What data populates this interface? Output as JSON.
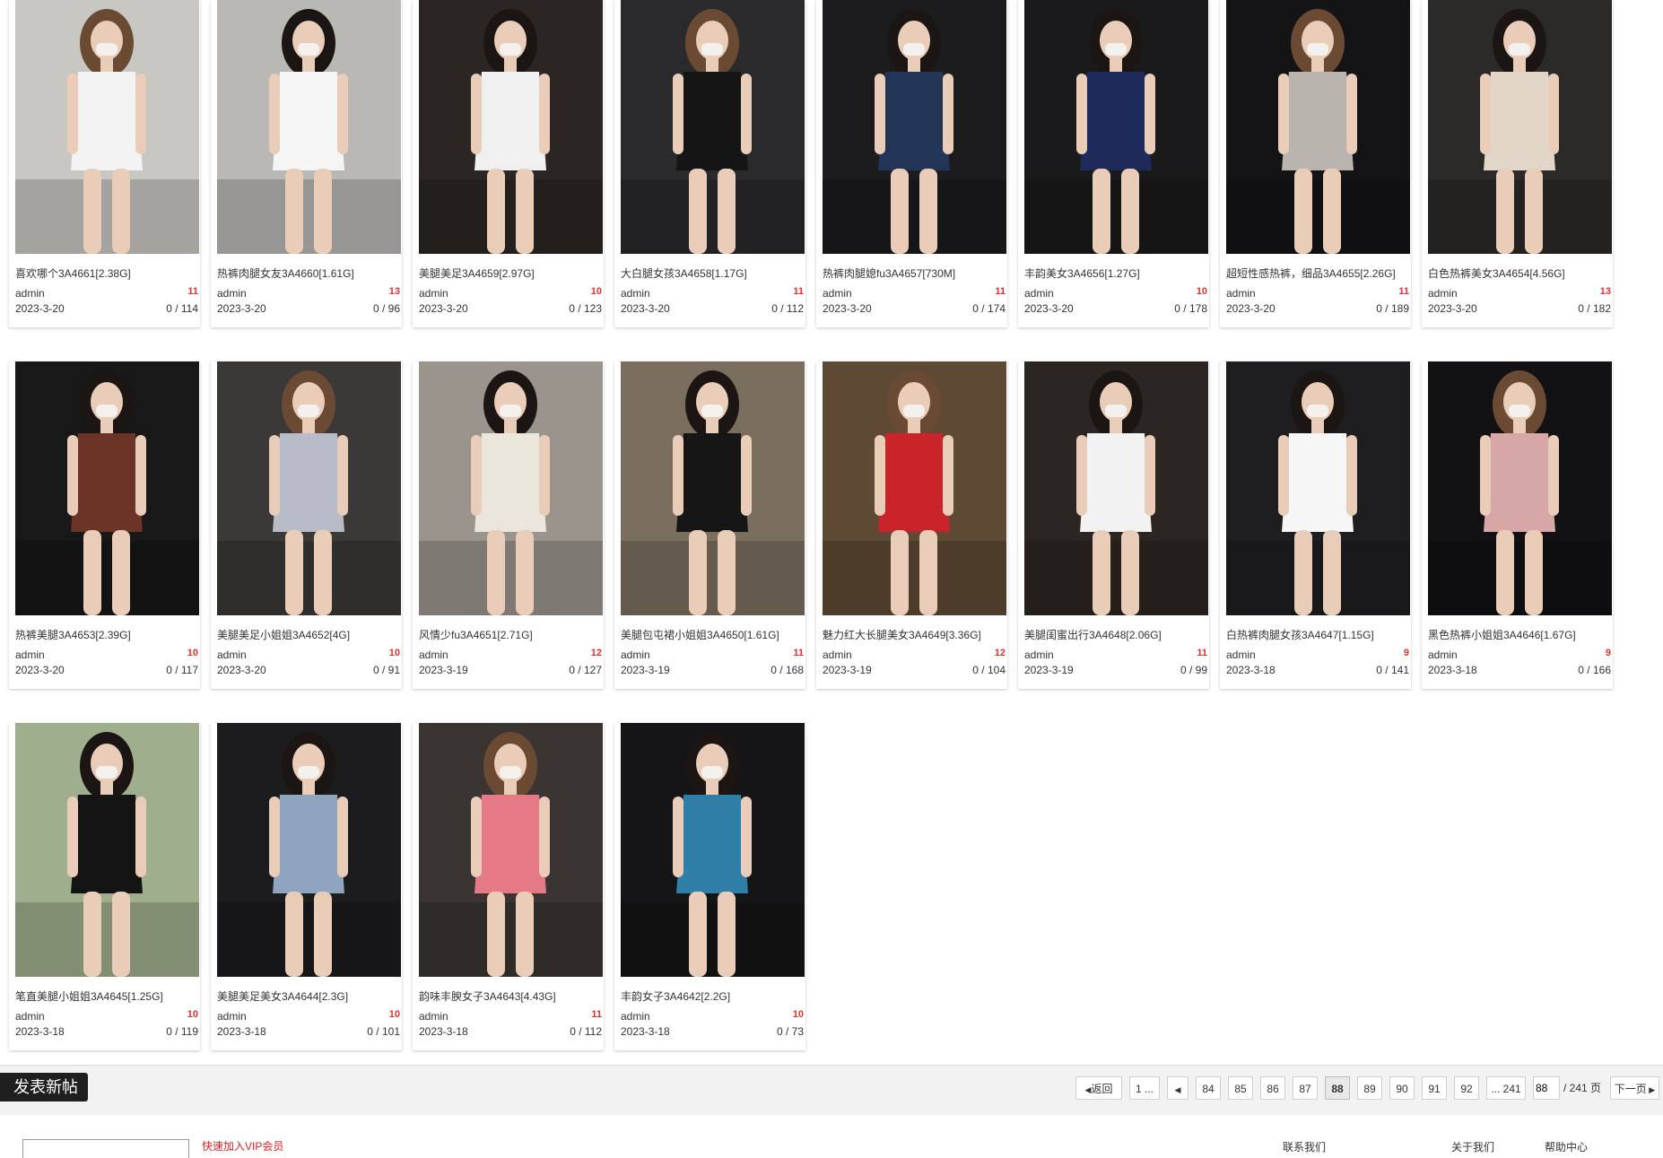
{
  "posts": [
    {
      "title": "喜欢哪个3A4661[2.38G]",
      "author": "admin",
      "images": "11",
      "date": "2023-3-20",
      "stats": "0 / 114",
      "bg": "#c9c7c2",
      "dress": "#f3f3f3"
    },
    {
      "title": "热裤肉腿女友3A4660[1.61G]",
      "author": "admin",
      "images": "13",
      "date": "2023-3-20",
      "stats": "0 / 96",
      "bg": "#b9b8b5",
      "dress": "#f5f5f5"
    },
    {
      "title": "美腿美足3A4659[2.97G]",
      "author": "admin",
      "images": "10",
      "date": "2023-3-20",
      "stats": "0 / 123",
      "bg": "#2b2623",
      "dress": "#f0f0f0"
    },
    {
      "title": "大白腿女孩3A4658[1.17G]",
      "author": "admin",
      "images": "11",
      "date": "2023-3-20",
      "stats": "0 / 112",
      "bg": "#2a2a2c",
      "dress": "#151515"
    },
    {
      "title": "热裤肉腿媳fu3A4657[730M]",
      "author": "admin",
      "images": "11",
      "date": "2023-3-20",
      "stats": "0 / 174",
      "bg": "#1c1c1e",
      "dress": "#223556"
    },
    {
      "title": "丰韵美女3A4656[1.27G]",
      "author": "admin",
      "images": "10",
      "date": "2023-3-20",
      "stats": "0 / 178",
      "bg": "#1a1a1c",
      "dress": "#1e2a5a"
    },
    {
      "title": "超短性感热裤，细品3A4655[2.26G]",
      "author": "admin",
      "images": "11",
      "date": "2023-3-20",
      "stats": "0 / 189",
      "bg": "#141416",
      "dress": "#b9b4ad"
    },
    {
      "title": "白色热裤美女3A4654[4.56G]",
      "author": "admin",
      "images": "13",
      "date": "2023-3-20",
      "stats": "0 / 182",
      "bg": "#2c2a28",
      "dress": "#e2d6c8"
    },
    {
      "title": "热裤美腿3A4653[2.39G]",
      "author": "admin",
      "images": "10",
      "date": "2023-3-20",
      "stats": "0 / 117",
      "bg": "#181818",
      "dress": "#6b3427"
    },
    {
      "title": "美腿美足小姐姐3A4652[4G]",
      "author": "admin",
      "images": "10",
      "date": "2023-3-20",
      "stats": "0 / 91",
      "bg": "#3a3937",
      "dress": "#b8bcc8"
    },
    {
      "title": "风情少fu3A4651[2.71G]",
      "author": "admin",
      "images": "12",
      "date": "2023-3-19",
      "stats": "0 / 127",
      "bg": "#9a948c",
      "dress": "#ebe6dc"
    },
    {
      "title": "美腿包屯裙小姐姐3A4650[1.61G]",
      "author": "admin",
      "images": "11",
      "date": "2023-3-19",
      "stats": "0 / 168",
      "bg": "#7a6e5e",
      "dress": "#161616"
    },
    {
      "title": "魅力红大长腿美女3A4649[3.36G]",
      "author": "admin",
      "images": "12",
      "date": "2023-3-19",
      "stats": "0 / 104",
      "bg": "#5e4a34",
      "dress": "#c8242a"
    },
    {
      "title": "美腿闺蜜出行3A4648[2.06G]",
      "author": "admin",
      "images": "11",
      "date": "2023-3-19",
      "stats": "0 / 99",
      "bg": "#2c2622",
      "dress": "#f2f2f2"
    },
    {
      "title": "白热裤肉腿女孩3A4647[1.15G]",
      "author": "admin",
      "images": "9",
      "date": "2023-3-18",
      "stats": "0 / 141",
      "bg": "#1e1e20",
      "dress": "#f6f6f6"
    },
    {
      "title": "黑色热裤小姐姐3A4646[1.67G]",
      "author": "admin",
      "images": "9",
      "date": "2023-3-18",
      "stats": "0 / 166",
      "bg": "#121214",
      "dress": "#d7a7a7"
    },
    {
      "title": "笔直美腿小姐姐3A4645[1.25G]",
      "author": "admin",
      "images": "10",
      "date": "2023-3-18",
      "stats": "0 / 119",
      "bg": "#9fae8c",
      "dress": "#141414"
    },
    {
      "title": "美腿美足美女3A4644[2.3G]",
      "author": "admin",
      "images": "10",
      "date": "2023-3-18",
      "stats": "0 / 101",
      "bg": "#1c1c1e",
      "dress": "#8ea4bf"
    },
    {
      "title": "韵味丰腴女子3A4643[4.43G]",
      "author": "admin",
      "images": "11",
      "date": "2023-3-18",
      "stats": "0 / 112",
      "bg": "#3a3532",
      "dress": "#e57a86"
    },
    {
      "title": "丰韵女子3A4642[2.2G]",
      "author": "admin",
      "images": "10",
      "date": "2023-3-18",
      "stats": "0 / 73",
      "bg": "#151517",
      "dress": "#2e7ea8"
    }
  ],
  "new_post_label": "发表新帖",
  "pagination": {
    "back": "返回",
    "first": "1 ...",
    "pages": [
      "84",
      "85",
      "86",
      "87",
      "88",
      "89",
      "90",
      "91",
      "92"
    ],
    "current": "88",
    "last": "... 241",
    "input_value": "88",
    "total": "/ 241 页",
    "next": "下一页"
  },
  "footer": {
    "link": "快速加入VIP会员",
    "text_1": "联系我们",
    "text_2": "关于我们",
    "text_3": "帮助中心"
  }
}
